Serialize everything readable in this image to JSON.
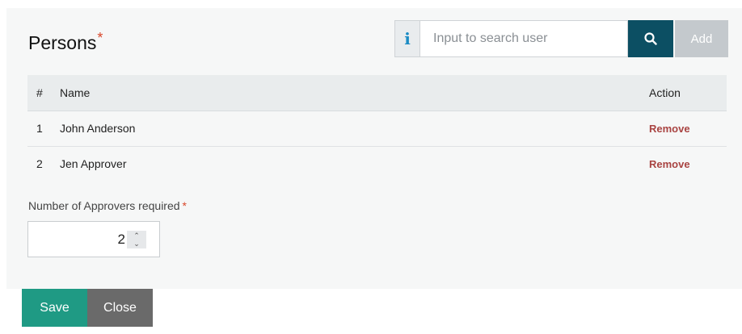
{
  "persons": {
    "title": "Persons",
    "required_mark": "*",
    "info_icon": "i",
    "search": {
      "placeholder": "Input to search user",
      "value": ""
    },
    "add_label": "Add",
    "table": {
      "headers": {
        "num": "#",
        "name": "Name",
        "action": "Action"
      },
      "rows": [
        {
          "num": "1",
          "name": "John Anderson",
          "action": "Remove"
        },
        {
          "num": "2",
          "name": "Jen Approver",
          "action": "Remove"
        }
      ]
    }
  },
  "approvers": {
    "label": "Number of Approvers required",
    "required_mark": "*",
    "value": "2"
  },
  "footer": {
    "save_label": "Save",
    "close_label": "Close"
  },
  "colors": {
    "search_button": "#0c4f63",
    "save_button": "#1f9a84",
    "close_button": "#6a6a6a",
    "remove_link": "#a94442",
    "required": "#d9472b",
    "info_icon": "#1a8bc4"
  },
  "icons": {
    "info": "info-icon",
    "search": "search-icon",
    "stepper_up": "chevron-up-icon",
    "stepper_down": "chevron-down-icon"
  }
}
